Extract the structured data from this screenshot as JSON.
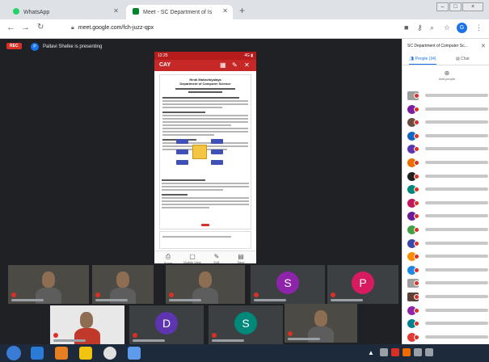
{
  "browser": {
    "tabs": [
      {
        "title": "WhatsApp",
        "favicon_color": "#25d366"
      },
      {
        "title": "Meet - SC Department of Is",
        "favicon_color": "#00832d",
        "active": true
      }
    ],
    "new_tab": "+",
    "url": "meet.google.com/fch-juzz-qpx",
    "window_controls": [
      "–",
      "□",
      "×"
    ]
  },
  "meet": {
    "recording_badge": "REC",
    "presenter_initial": "P",
    "presenting_text": "Pallavi Shelke is presenting"
  },
  "phone": {
    "status": "12:25",
    "status_right": "4G ▮",
    "app_title": "CAY",
    "doc_title_lines": [
      "Hindi Mahavidyalaya",
      "Department of Computer Science"
    ],
    "bottom_items": [
      "Share",
      "Mobile View",
      "Edit",
      "Save"
    ]
  },
  "panel": {
    "title": "SC Department of Computer Sc...",
    "tabs": {
      "people": "People (34)",
      "chat": "Chat"
    },
    "add_label": "Add people",
    "participants": [
      {
        "initial": "",
        "color": "#9e9e9e",
        "photo": true
      },
      {
        "initial": "",
        "color": "#7b1fa2"
      },
      {
        "initial": "",
        "color": "#6d4c41"
      },
      {
        "initial": "",
        "color": "#1565c0"
      },
      {
        "initial": "",
        "color": "#5e35b1"
      },
      {
        "initial": "",
        "color": "#ef6c00"
      },
      {
        "initial": "",
        "color": "#212121"
      },
      {
        "initial": "",
        "color": "#00897b"
      },
      {
        "initial": "",
        "color": "#c2185b"
      },
      {
        "initial": "",
        "color": "#6a1b9a"
      },
      {
        "initial": "",
        "color": "#43a047"
      },
      {
        "initial": "",
        "color": "#3949ab"
      },
      {
        "initial": "",
        "color": "#fb8c00"
      },
      {
        "initial": "",
        "color": "#1e88e5"
      },
      {
        "initial": "",
        "color": "#9e9e9e",
        "photo": true
      },
      {
        "initial": "",
        "color": "#5d4037",
        "photo": true
      },
      {
        "initial": "",
        "color": "#8e24aa"
      },
      {
        "initial": "",
        "color": "#00838f"
      },
      {
        "initial": "",
        "color": "#e53935"
      },
      {
        "initial": "",
        "color": "#546e7a"
      }
    ]
  },
  "tiles": [
    {
      "kind": "video",
      "name": ""
    },
    {
      "kind": "video",
      "name": ""
    },
    {
      "kind": "video",
      "name": ""
    },
    {
      "kind": "avatar",
      "initial": "S",
      "color": "#8e24aa",
      "name": ""
    },
    {
      "kind": "avatar",
      "initial": "P",
      "color": "#d81b60",
      "name": ""
    },
    {
      "kind": "photo",
      "name": ""
    },
    {
      "kind": "avatar",
      "initial": "D",
      "color": "#5e35b1",
      "name": ""
    },
    {
      "kind": "avatar",
      "initial": "S",
      "color": "#00897b",
      "name": ""
    },
    {
      "kind": "video",
      "name": ""
    }
  ],
  "taskbar": {
    "apps": [
      {
        "name": "ie-icon",
        "color": "#2b7bd6"
      },
      {
        "name": "media-player-icon",
        "color": "#e67e22"
      },
      {
        "name": "file-explorer-icon",
        "color": "#f1c40f"
      },
      {
        "name": "chrome-icon",
        "color": "#e0e0e0"
      },
      {
        "name": "screenshot-tool-icon",
        "color": "#5d9cec"
      }
    ],
    "time": "",
    "date": ""
  }
}
